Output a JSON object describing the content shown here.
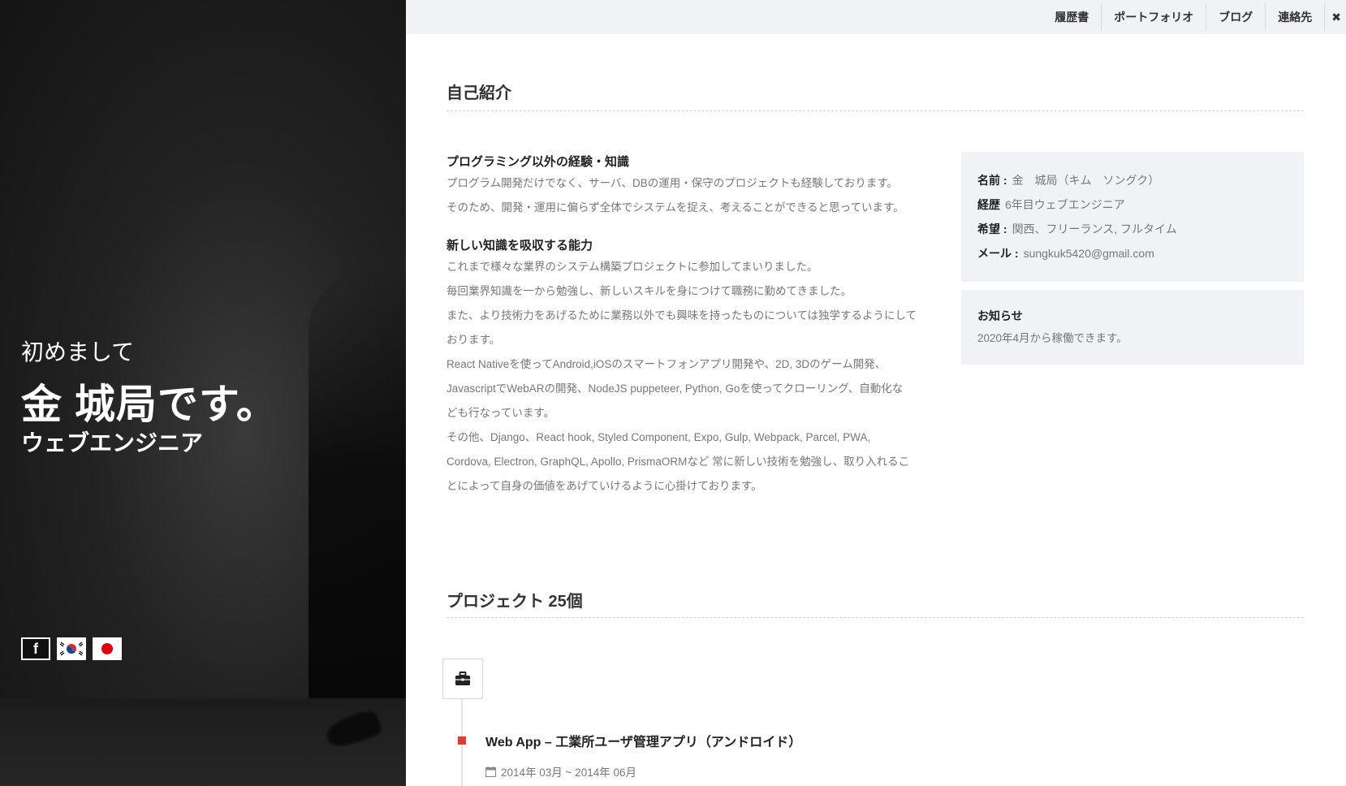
{
  "hero": {
    "greeting": "初めまして",
    "name": "金 城局です。",
    "role": "ウェブエンジニア",
    "social": [
      {
        "name": "facebook",
        "label": "f"
      },
      {
        "name": "korea-flag"
      },
      {
        "name": "japan-flag"
      }
    ]
  },
  "nav": {
    "items": [
      "履歴書",
      "ポートフォリオ",
      "ブログ",
      "連絡先"
    ],
    "close_label": "✖"
  },
  "about": {
    "title": "自己紹介",
    "blocks": [
      {
        "heading": "プログラミング以外の経験・知識",
        "lines": [
          "プログラム開発だけでなく、サーバ、DBの運用・保守のプロジェクトも経験しております。",
          "そのため、開発・運用に偏らず全体でシステムを捉え、考えることができると思っています。"
        ]
      },
      {
        "heading": "新しい知識を吸収する能力",
        "lines": [
          "これまで様々な業界のシステム構築プロジェクトに参加してまいりました。",
          "毎回業界知識を一から勉強し、新しいスキルを身につけて職務に勤めてきました。",
          "また、より技術力をあげるために業務以外でも興味を持ったものについては独学するようにして",
          "おります。",
          "React Nativeを使ってAndroid,iOSのスマートフォンアプリ開発や、2D, 3Dのゲーム開発、",
          "JavascriptでWebARの開発、NodeJS puppeteer, Python, Goを使ってクローリング、自動化な",
          "ども行なっています。",
          "その他、Django、React hook, Styled Component, Expo, Gulp, Webpack, Parcel, PWA,",
          "Cordova, Electron, GraphQL, Apollo, PrismaORMなど 常に新しい技術を勉強し、取り入れるこ",
          "とによって自身の価値をあげていけるように心掛けております。"
        ]
      }
    ]
  },
  "profile": {
    "name_label": "名前 :",
    "name_value": "金　城局（キム　ソングク）",
    "career_label": "経歴",
    "career_value": "6年目ウェブエンジニア",
    "wish_label": "希望 :",
    "wish_value": "関西、フリーランス, フルタイム",
    "mail_label": "メール :",
    "mail_value": "sungkuk5420@gmail.com"
  },
  "notice": {
    "title": "お知らせ",
    "text": "2020年4月から稼働できます。"
  },
  "projects": {
    "title": "プロジェクト 25個",
    "items": [
      {
        "title": "Web App – 工業所ユーザ管理アプリ（アンドロイド）",
        "date": "2014年 03月 ~ 2014年 06月"
      }
    ]
  },
  "colors": {
    "accent": "#e53935",
    "panel": "#f1f2f5"
  }
}
